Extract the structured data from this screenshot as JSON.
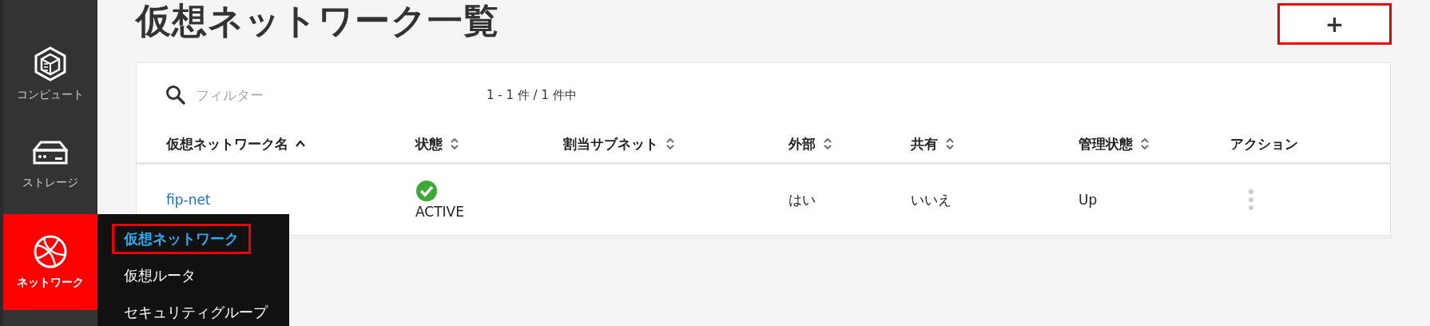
{
  "sidebar": {
    "items": [
      {
        "label": "コンピュート",
        "kind": "compute",
        "selected": false
      },
      {
        "label": "ストレージ",
        "kind": "storage",
        "selected": false
      },
      {
        "label": "ネットワーク",
        "kind": "network",
        "selected": true
      }
    ]
  },
  "submenu": {
    "items": [
      {
        "label": "仮想ネットワーク",
        "selected": true
      },
      {
        "label": "仮想ルータ",
        "selected": false
      },
      {
        "label": "セキュリティグループ",
        "selected": false
      }
    ]
  },
  "page": {
    "title": "仮想ネットワーク一覧",
    "add_button": "+"
  },
  "filter": {
    "placeholder": "フィルター"
  },
  "pagination": "1 - 1 件 / 1 件中",
  "table": {
    "columns": [
      {
        "label": "仮想ネットワーク名",
        "kind": "sorted"
      },
      {
        "label": "状態",
        "kind": "sortable"
      },
      {
        "label": "割当サブネット",
        "kind": "sortable"
      },
      {
        "label": "外部",
        "kind": "sortable"
      },
      {
        "label": "共有",
        "kind": "sortable"
      },
      {
        "label": "管理状態",
        "kind": "sortable"
      },
      {
        "label": "アクション",
        "kind": "plain"
      }
    ],
    "rows": [
      {
        "name": "fip-net",
        "status": {
          "text": "ACTIVE",
          "kind": "ok"
        },
        "external": "はい",
        "shared": "いいえ",
        "admin_state": "Up"
      }
    ]
  }
}
